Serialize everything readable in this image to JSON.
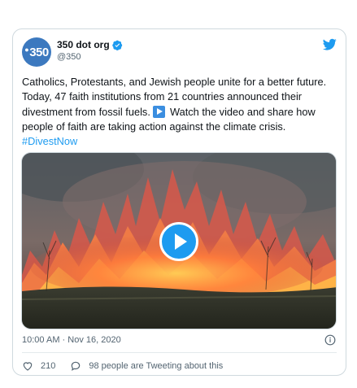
{
  "tweet": {
    "avatar_text": "350",
    "display_name": "350 dot org",
    "handle": "@350",
    "text_part1": "Catholics, Protestants, and Jewish people unite for a better future. Today, 47 faith institutions from 21 countries announced their divestment from fossil fuels. ",
    "text_part2": " Watch the video and share how people of faith are taking action against the climate crisis. ",
    "hashtag": "#DivestNow",
    "timestamp": "10:00 AM · Nov 16, 2020",
    "likes": "210",
    "tweeting_text": "98 people are Tweeting about this"
  },
  "icons": {
    "verified": "verified-badge-icon",
    "brand": "twitter-bird-icon",
    "inline_emoji": "play-button-emoji-icon",
    "video_play": "play-icon",
    "info": "info-icon",
    "like": "heart-icon",
    "reply": "speech-bubble-icon"
  },
  "colors": {
    "accent": "#1d9bf0",
    "avatar_bg": "#3c79bf",
    "secondary_text": "#536471",
    "border": "#cfd9de"
  }
}
